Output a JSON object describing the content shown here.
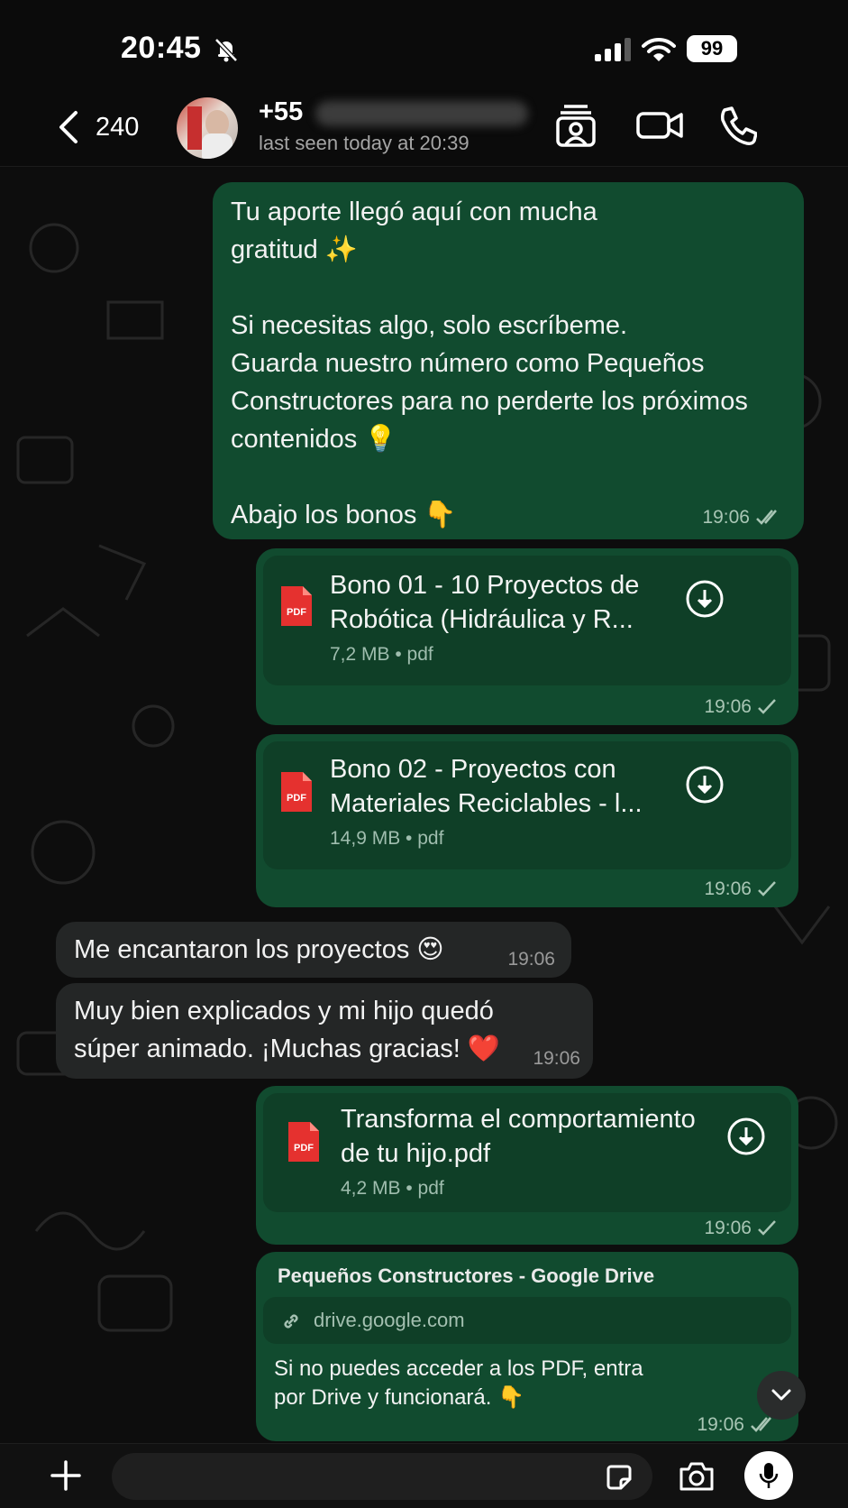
{
  "status_bar": {
    "time": "20:45",
    "battery": "99"
  },
  "header": {
    "back_count": "240",
    "contact_name": "+55",
    "last_seen": "last seen today at 20:39"
  },
  "messages": {
    "m1": {
      "text": "Tu aporte llegó aquí con mucha\ngratitud ✨\n\nSi necesitas algo, solo escríbeme.\nGuarda nuestro número como Pequeños\nConstructores para no perderte los próximos\ncontenidos 💡\n\nAbajo los bonos 👇",
      "time": "19:06"
    },
    "doc1": {
      "title_line1": "Bono 01 - 10 Proyectos de",
      "title_line2": "Robótica (Hidráulica y R...",
      "meta": "7,2 MB • pdf",
      "time": "19:06"
    },
    "doc2": {
      "title_line1": "Bono 02 - Proyectos con",
      "title_line2": "Materiales Reciclables - l...",
      "meta": "14,9 MB • pdf",
      "time": "19:06"
    },
    "in1": {
      "text": "Me encantaron los proyectos 😍",
      "time": "19:06"
    },
    "in2": {
      "line1": "Muy bien explicados y mi hijo quedó",
      "line2": "súper animado. ¡Muchas gracias! ❤️",
      "time": "19:06"
    },
    "doc3": {
      "title_line1": "Transforma el comportamiento",
      "title_line2": "de tu hijo.pdf",
      "meta": "4,2 MB • pdf",
      "time": "19:06"
    },
    "link": {
      "title": "Pequeños Constructores - Google Drive",
      "domain": "drive.google.com",
      "body": "Si no puedes acceder a los PDF, entra\npor Drive y funcionará. 👇",
      "time": "19:06"
    }
  },
  "pdf_label": "PDF",
  "colors": {
    "outgoing": "#114b2f",
    "incoming": "#242626",
    "card": "#0f3f27"
  }
}
